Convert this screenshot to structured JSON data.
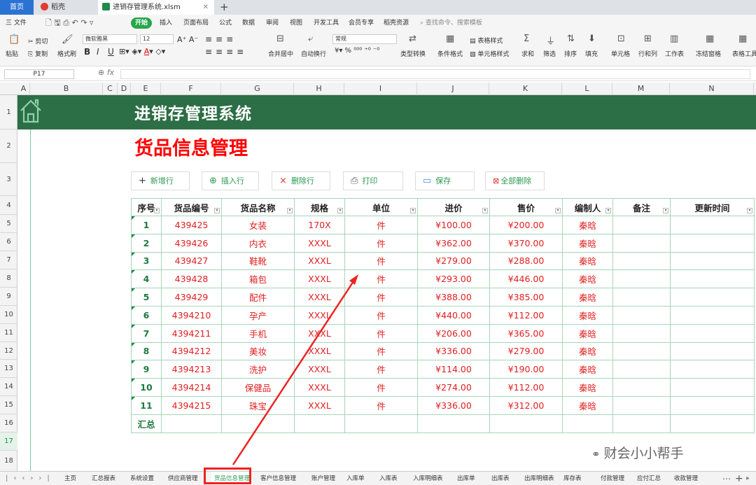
{
  "tabs": {
    "home": "首页",
    "daoke": "稻壳",
    "file": "进销存管理系统.xlsm"
  },
  "menu": {
    "file": "三 文件",
    "start": "开始",
    "items": [
      "插入",
      "页面布局",
      "公式",
      "数据",
      "审阅",
      "视图",
      "开发工具",
      "会员专享",
      "稻壳资源"
    ],
    "search": "查找命令、搜索模板"
  },
  "toolbar": {
    "cut": "剪切",
    "paste": "粘贴",
    "copy": "复制",
    "format_painter": "格式刷",
    "font": "微软雅黑",
    "size": "12",
    "merge": "合并居中",
    "wrap": "自动换行",
    "numfmt": "常规",
    "convert": "类型转换",
    "cond": "条件格式",
    "tablestyle": "表格样式",
    "cellstyle": "单元格样式",
    "sum": "求和",
    "filter": "筛选",
    "sort": "排序",
    "fill": "填充",
    "cell": "单元格",
    "rowcol": "行和列",
    "sheet": "工作表",
    "freeze": "冻结窗格",
    "tabletool": "表格工具"
  },
  "formula": {
    "cell": "P17",
    "fx": "fx",
    "value": ""
  },
  "columns": [
    "A",
    "B",
    "C",
    "D",
    "E",
    "F",
    "G",
    "H",
    "I",
    "J",
    "K",
    "L",
    "M",
    "N"
  ],
  "rows": [
    "1",
    "2",
    "3",
    "4",
    "5",
    "6",
    "7",
    "8",
    "9",
    "10",
    "11",
    "12",
    "13",
    "14",
    "15",
    "16",
    "17",
    "18"
  ],
  "title": "进销存管理系统",
  "subtitle": "货品信息管理",
  "buttons": {
    "add_row": "新增行",
    "insert_row": "插入行",
    "delete_row": "删除行",
    "print": "打印",
    "save": "保存",
    "delete_all": "全部删除"
  },
  "table": {
    "headers": [
      "序号",
      "货品编号",
      "货品名称",
      "规格",
      "单位",
      "进价",
      "售价",
      "编制人",
      "备注",
      "更新时间"
    ],
    "rows": [
      [
        "1",
        "439425",
        "女装",
        "170X",
        "件",
        "¥100.00",
        "¥200.00",
        "秦晗"
      ],
      [
        "2",
        "439426",
        "内衣",
        "XXXL",
        "件",
        "¥362.00",
        "¥370.00",
        "秦晗"
      ],
      [
        "3",
        "439427",
        "鞋靴",
        "XXXL",
        "件",
        "¥279.00",
        "¥288.00",
        "秦晗"
      ],
      [
        "4",
        "439428",
        "箱包",
        "XXXL",
        "件",
        "¥293.00",
        "¥446.00",
        "秦晗"
      ],
      [
        "5",
        "439429",
        "配件",
        "XXXL",
        "件",
        "¥388.00",
        "¥385.00",
        "秦晗"
      ],
      [
        "6",
        "4394210",
        "孕产",
        "XXXL",
        "件",
        "¥440.00",
        "¥112.00",
        "秦晗"
      ],
      [
        "7",
        "4394211",
        "手机",
        "XXXL",
        "件",
        "¥206.00",
        "¥365.00",
        "秦晗"
      ],
      [
        "8",
        "4394212",
        "美妆",
        "XXXL",
        "件",
        "¥336.00",
        "¥279.00",
        "秦晗"
      ],
      [
        "9",
        "4394213",
        "洗护",
        "XXXL",
        "件",
        "¥114.00",
        "¥190.00",
        "秦晗"
      ],
      [
        "10",
        "4394214",
        "保健品",
        "XXXL",
        "件",
        "¥274.00",
        "¥112.00",
        "秦晗"
      ],
      [
        "11",
        "4394215",
        "珠宝",
        "XXXL",
        "件",
        "¥336.00",
        "¥312.00",
        "秦晗"
      ]
    ],
    "total_label": "汇总"
  },
  "watermark": "财会小小帮手",
  "sheet_tabs": [
    "主页",
    "汇总报表",
    "系统设置",
    "供应商管理",
    "货品信息管理",
    "客户信息管理",
    "账户管理",
    "入库单",
    "入库表",
    "入库明细表",
    "出库单",
    "出库表",
    "出库明细表",
    "库存表",
    "付款管理",
    "应付汇总",
    "收款管理"
  ],
  "colors": {
    "banner": "#2c6e45",
    "accent_green": "#27a64c",
    "red": "#ff0000",
    "annotation": "#ee2222"
  }
}
